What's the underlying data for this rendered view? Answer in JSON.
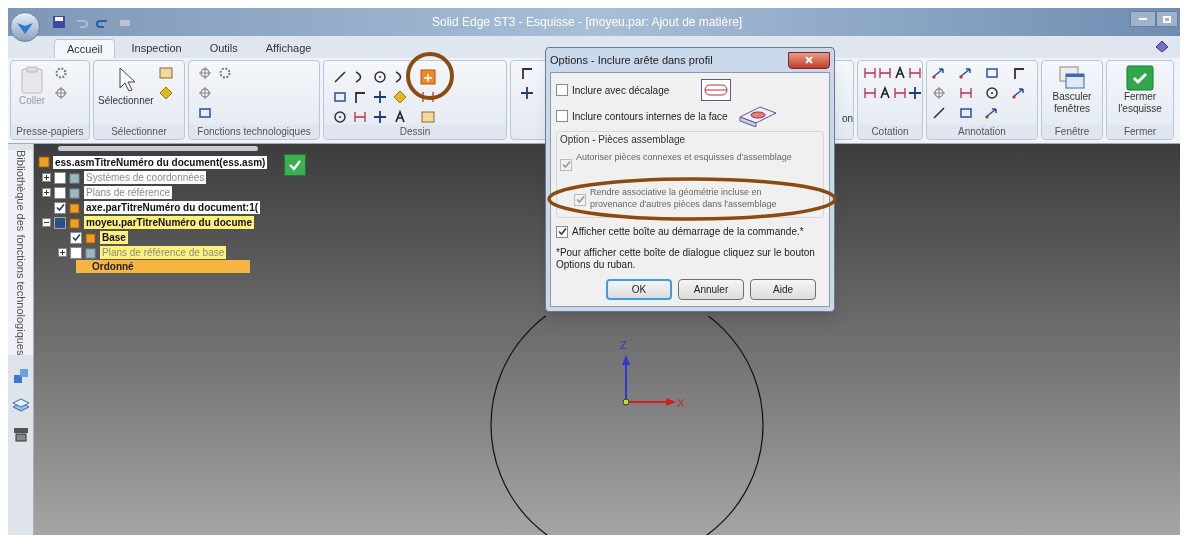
{
  "window": {
    "title": "Solid Edge ST3 - Esquisse - [moyeu.par: Ajout de matière]"
  },
  "tabs": [
    {
      "label": "Accueil",
      "selected": true
    },
    {
      "label": "Inspection",
      "selected": false
    },
    {
      "label": "Outils",
      "selected": false
    },
    {
      "label": "Affichage",
      "selected": false
    }
  ],
  "ribbon_groups": [
    {
      "kind": "clipboard",
      "label": "Presse-papiers",
      "buttons": [
        {
          "label": "Coller",
          "disabled": true
        }
      ]
    },
    {
      "kind": "select",
      "label": "Sélectionner",
      "buttons": [
        {
          "label": "Sélectionner"
        }
      ]
    },
    {
      "kind": "features",
      "label": "Fonctions technologiques"
    },
    {
      "kind": "draw",
      "label": "Dessin"
    },
    {
      "kind": "relate",
      "buttons": [
        {
          "label": "on"
        }
      ]
    },
    {
      "kind": "dimension",
      "label": "Cotation"
    },
    {
      "kind": "annotation",
      "label": "Annotation"
    },
    {
      "kind": "window",
      "label": "Fenêtre",
      "buttons": [
        {
          "label": "Basculer fenêtres"
        }
      ]
    },
    {
      "kind": "close",
      "label": "Fermer",
      "buttons": [
        {
          "label": "Fermer l'esquisse"
        }
      ]
    }
  ],
  "side_panel": {
    "label": "Bibliothèque des fonctions technologiques"
  },
  "tree": {
    "label": "ess.asmTitreNuméro du document(ess.asm)",
    "children": [
      {
        "label": "Systèmes de coordonnées",
        "expanded": false,
        "checked": false,
        "dimmed": true,
        "highlighted": false
      },
      {
        "label": "Plans de référence",
        "expanded": false,
        "checked": false,
        "dimmed": true,
        "highlighted": false
      },
      {
        "label": "axe.parTitreNuméro du document:1(",
        "checked": true,
        "dimmed": false,
        "highlighted": false
      },
      {
        "label": "moyeu.parTitreNuméro du docume",
        "expanded": true,
        "kind": "active",
        "dimmed": false,
        "highlighted": true,
        "children": [
          {
            "label": "Base",
            "checked": true,
            "dimmed": false,
            "highlighted": true
          },
          {
            "label": "Plans de référence de base",
            "expanded": false,
            "checked": false,
            "dimmed": true,
            "highlighted": true
          }
        ]
      }
    ],
    "footer": "Ordonné"
  },
  "viewport": {
    "axes": [
      "Z",
      "X"
    ]
  },
  "dialog": {
    "title": "Options - Inclure arête dans profil",
    "options": [
      {
        "label": "Inclure avec décalage",
        "checked": false,
        "disabled": false,
        "kind": "offset"
      },
      {
        "label": "Inclure contours internes de la face",
        "checked": false,
        "disabled": false,
        "kind": "face"
      }
    ],
    "group": {
      "title": "Option - Pièces assemblage",
      "options": [
        {
          "label": "Autoriser pièces connexes et esquisses d'assemblage",
          "checked": true,
          "disabled": true,
          "indented": false
        },
        {
          "label": "Rendre associative la géométrie incluse en provenance d'autres pièces dans l'assemblage",
          "checked": true,
          "disabled": true,
          "indented": true
        }
      ]
    },
    "show_option": {
      "label": "Afficher cette boîte au démarrage de la commande.*",
      "checked": true,
      "disabled": false
    },
    "note": "*Pour afficher cette boîte de dialogue cliquez sur le bouton Options du ruban.",
    "buttons": [
      {
        "label": "OK",
        "selected": true
      },
      {
        "label": "Annuler",
        "selected": false
      },
      {
        "label": "Aide",
        "selected": false
      }
    ]
  }
}
